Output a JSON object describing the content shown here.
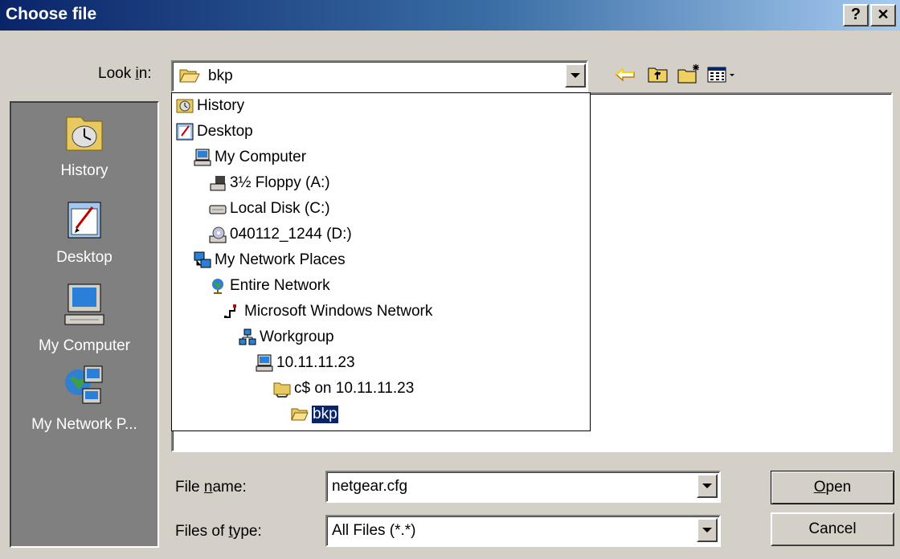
{
  "window": {
    "title": "Choose file",
    "help_btn": "?",
    "close_btn": "✕"
  },
  "lookin": {
    "label_pre": "Look ",
    "label_u": "i",
    "label_post": "n:",
    "value": "bkp"
  },
  "places": [
    {
      "label": "History"
    },
    {
      "label": "Desktop"
    },
    {
      "label": "My Computer"
    },
    {
      "label": "My Network P..."
    }
  ],
  "tree": [
    {
      "label": "History",
      "icon": "history-icon"
    },
    {
      "label": "Desktop",
      "icon": "desktop-icon"
    },
    {
      "label": "My Computer",
      "icon": "computer-icon"
    },
    {
      "label": "3½ Floppy (A:)",
      "icon": "floppy-icon"
    },
    {
      "label": "Local Disk (C:)",
      "icon": "disk-icon"
    },
    {
      "label": "040112_1244 (D:)",
      "icon": "cdrom-icon"
    },
    {
      "label": "My Network Places",
      "icon": "network-places-icon"
    },
    {
      "label": "Entire Network",
      "icon": "globe-icon"
    },
    {
      "label": "Microsoft Windows Network",
      "icon": "network-icon"
    },
    {
      "label": "Workgroup",
      "icon": "workgroup-icon"
    },
    {
      "label": "10.11.11.23",
      "icon": "computer-icon"
    },
    {
      "label": "c$ on 10.11.11.23",
      "icon": "share-icon"
    },
    {
      "label": "bkp",
      "icon": "folder-open-icon"
    }
  ],
  "filename": {
    "label_pre": "File ",
    "label_u": "n",
    "label_post": "ame:",
    "value": "netgear.cfg"
  },
  "filetype": {
    "label_pre": "Files of ",
    "label_u": "t",
    "label_post": "ype:",
    "value": "All Files (*.*)"
  },
  "buttons": {
    "open_u": "O",
    "open_rest": "pen",
    "cancel": "Cancel"
  },
  "colors": {
    "titlebar": "#0a246a",
    "face": "#d4d0c8",
    "places": "#808080",
    "selection": "#0a246a"
  }
}
